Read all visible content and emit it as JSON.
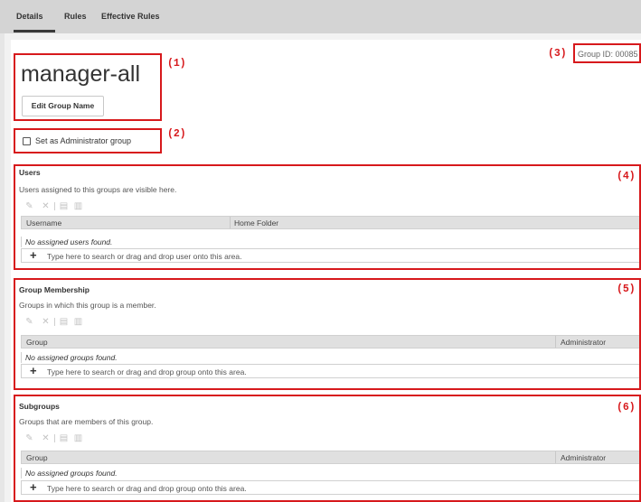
{
  "tabs": [
    {
      "label": "Details"
    },
    {
      "label": "Rules"
    },
    {
      "label": "Effective Rules"
    }
  ],
  "group": {
    "name": "manager-all",
    "edit_button": "Edit Group Name",
    "admin_checkbox_label": "Set as Administrator group",
    "admin_checked": false,
    "group_id": "Group ID: 00085"
  },
  "annotations": [
    "(1)",
    "(2)",
    "(3)",
    "(4)",
    "(5)",
    "(6)"
  ],
  "colors": {
    "annotation": "#d7191c",
    "tab_bar": "#d4d4d4",
    "header_row": "#e0e0e0"
  },
  "toolbar_icons": [
    "pencil-icon",
    "close-icon",
    "document-icon",
    "copy-icon"
  ],
  "sections": {
    "users": {
      "title": "Users",
      "description": "Users assigned to this groups are visible here.",
      "columns": [
        "Username",
        "Home Folder"
      ],
      "empty_text": "No assigned users found.",
      "search_placeholder": "Type here to search or drag and drop user onto this area."
    },
    "membership": {
      "title": "Group Membership",
      "description": "Groups in which this group is a member.",
      "columns": [
        "Group",
        "Administrator"
      ],
      "empty_text": "No assigned groups found.",
      "search_placeholder": "Type here to search or drag and drop group onto this area."
    },
    "subgroups": {
      "title": "Subgroups",
      "description": "Groups that are members of this group.",
      "columns": [
        "Group",
        "Administrator"
      ],
      "empty_text": "No assigned groups found.",
      "search_placeholder": "Type here to search or drag and drop group onto this area."
    }
  }
}
